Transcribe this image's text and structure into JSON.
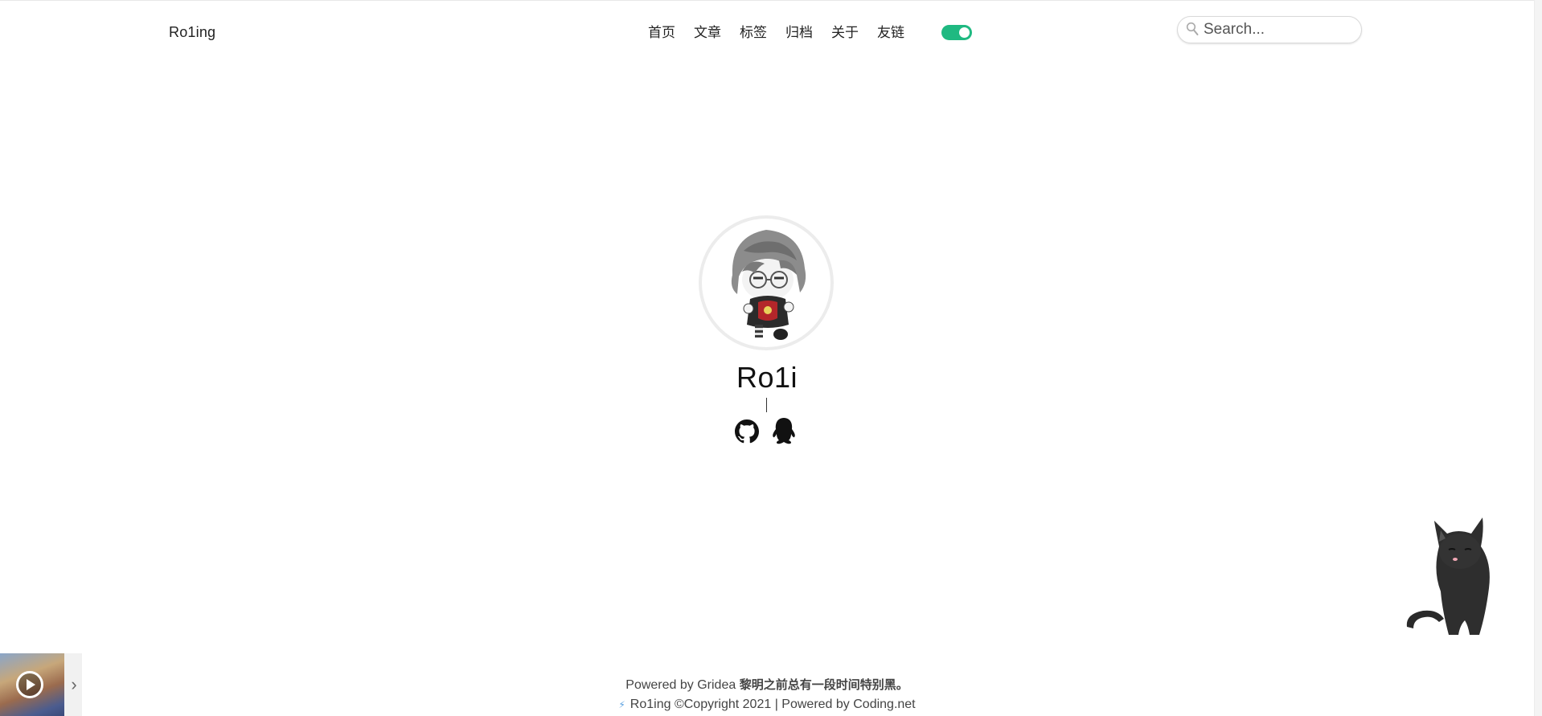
{
  "header": {
    "brand": "Ro1ing",
    "nav": [
      "首页",
      "文章",
      "标签",
      "归档",
      "关于",
      "友链"
    ],
    "theme_toggle": {
      "state": "on",
      "color": "#1fb981"
    },
    "search": {
      "placeholder": "Search..."
    }
  },
  "profile": {
    "name": "Ro1i",
    "cursor": "|",
    "social_icons": [
      "github-icon",
      "qq-icon"
    ]
  },
  "footer": {
    "powered_prefix": "Powered by Gridea",
    "motto": "黎明之前总有一段时间特别黑。",
    "copyright": "Ro1ing ©Copyright 2021 | Powered by Coding.net"
  },
  "player": {
    "controls": [
      "play-icon",
      "chevron-right-icon"
    ]
  }
}
